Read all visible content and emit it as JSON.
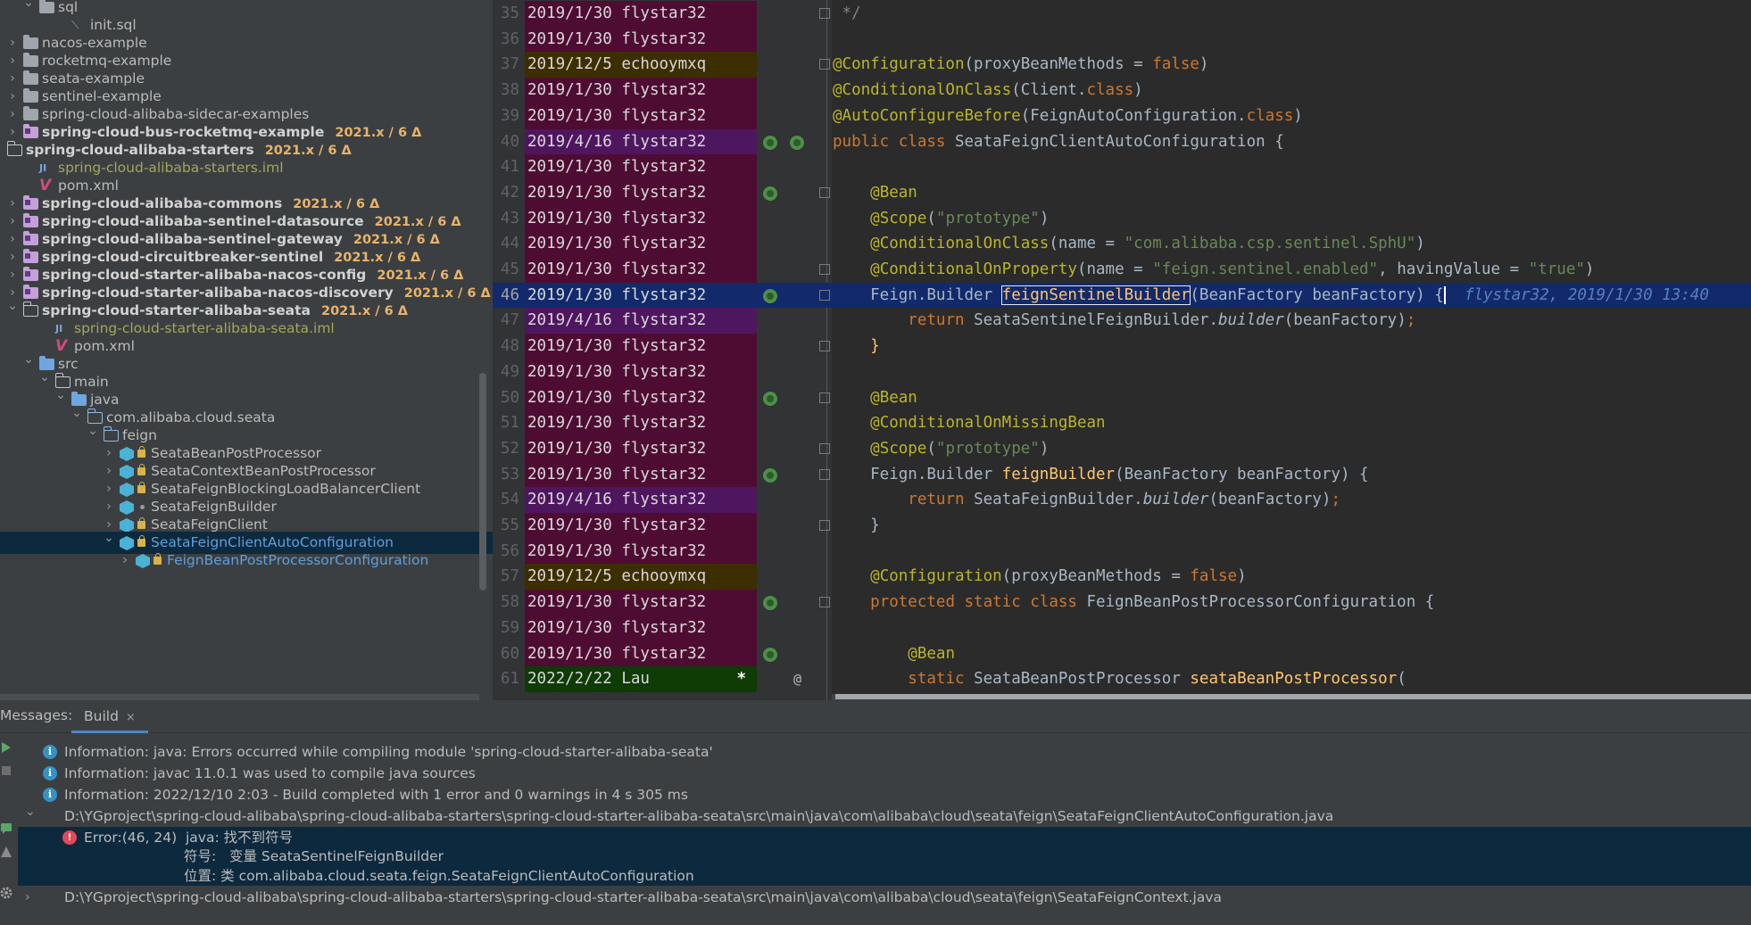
{
  "project_tree": {
    "items": [
      {
        "label": "sql",
        "indent": 1,
        "arrow": "down",
        "icon": "folder",
        "style": "normal"
      },
      {
        "label": "init.sql",
        "indent": 3,
        "arrow": "",
        "icon": "sql-file",
        "style": "normal"
      },
      {
        "label": "nacos-example",
        "indent": 0,
        "arrow": "right",
        "icon": "folder",
        "style": "normal"
      },
      {
        "label": "rocketmq-example",
        "indent": 0,
        "arrow": "right",
        "icon": "folder",
        "style": "normal"
      },
      {
        "label": "seata-example",
        "indent": 0,
        "arrow": "right",
        "icon": "folder",
        "style": "normal"
      },
      {
        "label": "sentinel-example",
        "indent": 0,
        "arrow": "right",
        "icon": "folder",
        "style": "normal"
      },
      {
        "label": "spring-cloud-alibaba-sidecar-examples",
        "indent": 0,
        "arrow": "right",
        "icon": "folder",
        "style": "normal"
      },
      {
        "label": "spring-cloud-bus-rocketmq-example",
        "tag": "2021.x / 6 Δ",
        "indent": 0,
        "arrow": "right",
        "icon": "module",
        "style": "module"
      },
      {
        "label": "spring-cloud-alibaba-starters",
        "tag": "2021.x / 6 Δ",
        "indent": -1,
        "arrow": "",
        "icon": "folder-outline",
        "style": "module"
      },
      {
        "label": "spring-cloud-alibaba-starters.iml",
        "indent": 1,
        "arrow": "",
        "icon": "iml-file",
        "style": "ignored"
      },
      {
        "label": "pom.xml",
        "indent": 1,
        "arrow": "",
        "icon": "maven-file",
        "style": "normal"
      },
      {
        "label": "spring-cloud-alibaba-commons",
        "tag": "2021.x / 6 Δ",
        "indent": 0,
        "arrow": "right",
        "icon": "module",
        "style": "module"
      },
      {
        "label": "spring-cloud-alibaba-sentinel-datasource",
        "tag": "2021.x / 6 Δ",
        "indent": 0,
        "arrow": "right",
        "icon": "module",
        "style": "module"
      },
      {
        "label": "spring-cloud-alibaba-sentinel-gateway",
        "tag": "2021.x / 6 Δ",
        "indent": 0,
        "arrow": "right",
        "icon": "module",
        "style": "module"
      },
      {
        "label": "spring-cloud-circuitbreaker-sentinel",
        "tag": "2021.x / 6 Δ",
        "indent": 0,
        "arrow": "right",
        "icon": "module",
        "style": "module"
      },
      {
        "label": "spring-cloud-starter-alibaba-nacos-config",
        "tag": "2021.x / 6 Δ",
        "indent": 0,
        "arrow": "right",
        "icon": "module",
        "style": "module"
      },
      {
        "label": "spring-cloud-starter-alibaba-nacos-discovery",
        "tag": "2021.x / 6 Δ",
        "indent": 0,
        "arrow": "right",
        "icon": "module",
        "style": "module"
      },
      {
        "label": "spring-cloud-starter-alibaba-seata",
        "tag": "2021.x / 6 Δ",
        "indent": 0,
        "arrow": "down",
        "icon": "module-outline",
        "style": "module"
      },
      {
        "label": "spring-cloud-starter-alibaba-seata.iml",
        "indent": 2,
        "arrow": "",
        "icon": "iml-file",
        "style": "ignored"
      },
      {
        "label": "pom.xml",
        "indent": 2,
        "arrow": "",
        "icon": "maven-file",
        "style": "normal"
      },
      {
        "label": "src",
        "indent": 1,
        "arrow": "down",
        "icon": "folder-src",
        "style": "normal"
      },
      {
        "label": "main",
        "indent": 2,
        "arrow": "down",
        "icon": "folder-outline",
        "style": "normal"
      },
      {
        "label": "java",
        "indent": 3,
        "arrow": "down",
        "icon": "folder-src",
        "style": "normal"
      },
      {
        "label": "com.alibaba.cloud.seata",
        "indent": 4,
        "arrow": "down",
        "icon": "package",
        "style": "normal"
      },
      {
        "label": "feign",
        "indent": 5,
        "arrow": "down",
        "icon": "package",
        "style": "normal"
      },
      {
        "label": "SeataBeanPostProcessor",
        "indent": 6,
        "arrow": "right",
        "icon": "class",
        "lock": true,
        "style": "normal"
      },
      {
        "label": "SeataContextBeanPostProcessor",
        "indent": 6,
        "arrow": "right",
        "icon": "class",
        "lock": true,
        "style": "normal"
      },
      {
        "label": "SeataFeignBlockingLoadBalancerClient",
        "indent": 6,
        "arrow": "right",
        "icon": "class",
        "lock": true,
        "style": "normal"
      },
      {
        "label": "SeataFeignBuilder",
        "indent": 6,
        "arrow": "right",
        "icon": "class",
        "dot": true,
        "style": "normal"
      },
      {
        "label": "SeataFeignClient",
        "indent": 6,
        "arrow": "right",
        "icon": "class",
        "lock": true,
        "style": "normal"
      },
      {
        "label": "SeataFeignClientAutoConfiguration",
        "indent": 6,
        "arrow": "down",
        "icon": "class",
        "lock": true,
        "style": "selected"
      },
      {
        "label": "FeignBeanPostProcessorConfiguration",
        "indent": 7,
        "arrow": "right",
        "icon": "class",
        "lock": true,
        "style": "selected-partial"
      }
    ]
  },
  "editor": {
    "lines": [
      {
        "num": "35",
        "blame": "2019/1/30 flystar32",
        "kind": "a",
        "gicon": false,
        "fold": true,
        "code": [
          [
            "cmt",
            " */"
          ]
        ]
      },
      {
        "num": "36",
        "blame": "2019/1/30 flystar32",
        "kind": "a",
        "gicon": false,
        "fold": false,
        "code": []
      },
      {
        "num": "37",
        "blame": "2019/12/5 echooymxq",
        "kind": "b",
        "gicon": false,
        "fold": true,
        "code": [
          [
            "ann",
            "@Configuration"
          ],
          [
            "",
            "(proxyBeanMethods = "
          ],
          [
            "kw",
            "false"
          ],
          [
            "",
            ")"
          ]
        ]
      },
      {
        "num": "38",
        "blame": "2019/1/30 flystar32",
        "kind": "a",
        "gicon": false,
        "fold": false,
        "code": [
          [
            "ann",
            "@ConditionalOnClass"
          ],
          [
            "",
            "(Client."
          ],
          [
            "kw",
            "class"
          ],
          [
            "",
            ")"
          ]
        ]
      },
      {
        "num": "39",
        "blame": "2019/1/30 flystar32",
        "kind": "a",
        "gicon": false,
        "fold": false,
        "code": [
          [
            "ann",
            "@AutoConfigureBefore"
          ],
          [
            "",
            "(FeignAutoConfiguration."
          ],
          [
            "kw",
            "class"
          ],
          [
            "",
            ")"
          ]
        ]
      },
      {
        "num": "40",
        "blame": "2019/4/16 flystar32",
        "kind": "c",
        "gicon": true,
        "fold": false,
        "code": [
          [
            "kw",
            "public class "
          ],
          [
            "",
            "SeataFeignClientAutoConfiguration {"
          ]
        ]
      },
      {
        "num": "41",
        "blame": "2019/1/30 flystar32",
        "kind": "a",
        "gicon": false,
        "fold": false,
        "code": []
      },
      {
        "num": "42",
        "blame": "2019/1/30 flystar32",
        "kind": "a",
        "gicon": true,
        "fold": true,
        "code": [
          [
            "",
            "    "
          ],
          [
            "ann",
            "@Bean"
          ]
        ]
      },
      {
        "num": "43",
        "blame": "2019/1/30 flystar32",
        "kind": "a",
        "gicon": false,
        "fold": false,
        "code": [
          [
            "",
            "    "
          ],
          [
            "ann",
            "@Scope"
          ],
          [
            "",
            "("
          ],
          [
            "str",
            "\"prototype\""
          ],
          [
            "",
            ")"
          ]
        ]
      },
      {
        "num": "44",
        "blame": "2019/1/30 flystar32",
        "kind": "a",
        "gicon": false,
        "fold": false,
        "code": [
          [
            "",
            "    "
          ],
          [
            "ann",
            "@ConditionalOnClass"
          ],
          [
            "",
            "(name = "
          ],
          [
            "str",
            "\"com.alibaba.csp.sentinel.SphU\""
          ],
          [
            "",
            ")"
          ]
        ]
      },
      {
        "num": "45",
        "blame": "2019/1/30 flystar32",
        "kind": "a",
        "gicon": false,
        "fold": true,
        "code": [
          [
            "",
            "    "
          ],
          [
            "ann",
            "@ConditionalOnProperty"
          ],
          [
            "",
            "(name = "
          ],
          [
            "str",
            "\"feign.sentinel.enabled\""
          ],
          [
            "",
            ", havingValue = "
          ],
          [
            "str",
            "\"true\""
          ],
          [
            "",
            ")"
          ]
        ]
      },
      {
        "num": "46",
        "blame": "2019/1/30 flystar32",
        "kind": "a",
        "gicon": true,
        "fold": true,
        "current": true,
        "code": [
          [
            "",
            "    Feign.Builder "
          ],
          [
            "fn hl",
            "feignSentinelBuilder"
          ],
          [
            "",
            "(BeanFactory beanFactory) {"
          ],
          [
            "caret",
            ""
          ],
          [
            "",
            "  "
          ],
          [
            "inlay",
            "flystar32, 2019/1/30 13:40"
          ]
        ]
      },
      {
        "num": "47",
        "blame": "2019/4/16 flystar32",
        "kind": "c",
        "gicon": false,
        "fold": false,
        "code": [
          [
            "",
            "        "
          ],
          [
            "kw",
            "return "
          ],
          [
            "",
            "SeataSentinelFeignBuilder."
          ],
          [
            "it",
            "builder"
          ],
          [
            "",
            "(beanFactory)"
          ],
          [
            "kw",
            ";"
          ]
        ]
      },
      {
        "num": "48",
        "blame": "2019/1/30 flystar32",
        "kind": "a",
        "gicon": false,
        "fold": true,
        "code": [
          [
            "",
            "    "
          ],
          [
            "fn",
            "}"
          ]
        ]
      },
      {
        "num": "49",
        "blame": "2019/1/30 flystar32",
        "kind": "a",
        "gicon": false,
        "fold": false,
        "code": []
      },
      {
        "num": "50",
        "blame": "2019/1/30 flystar32",
        "kind": "a",
        "gicon": true,
        "fold": true,
        "code": [
          [
            "",
            "    "
          ],
          [
            "ann",
            "@Bean"
          ]
        ]
      },
      {
        "num": "51",
        "blame": "2019/1/30 flystar32",
        "kind": "a",
        "gicon": false,
        "fold": false,
        "code": [
          [
            "",
            "    "
          ],
          [
            "ann",
            "@ConditionalOnMissingBean"
          ]
        ]
      },
      {
        "num": "52",
        "blame": "2019/1/30 flystar32",
        "kind": "a",
        "gicon": false,
        "fold": true,
        "code": [
          [
            "",
            "    "
          ],
          [
            "ann",
            "@Scope"
          ],
          [
            "",
            "("
          ],
          [
            "str",
            "\"prototype\""
          ],
          [
            "",
            ")"
          ]
        ]
      },
      {
        "num": "53",
        "blame": "2019/1/30 flystar32",
        "kind": "a",
        "gicon": true,
        "fold": true,
        "code": [
          [
            "",
            "    Feign.Builder "
          ],
          [
            "fn",
            "feignBuilder"
          ],
          [
            "",
            "(BeanFactory beanFactory) {"
          ]
        ]
      },
      {
        "num": "54",
        "blame": "2019/4/16 flystar32",
        "kind": "c",
        "gicon": false,
        "fold": false,
        "code": [
          [
            "",
            "        "
          ],
          [
            "kw",
            "return "
          ],
          [
            "",
            "SeataFeignBuilder."
          ],
          [
            "it",
            "builder"
          ],
          [
            "",
            "(beanFactory)"
          ],
          [
            "kw",
            ";"
          ]
        ]
      },
      {
        "num": "55",
        "blame": "2019/1/30 flystar32",
        "kind": "a",
        "gicon": false,
        "fold": true,
        "code": [
          [
            "",
            "    }"
          ]
        ]
      },
      {
        "num": "56",
        "blame": "2019/1/30 flystar32",
        "kind": "a",
        "gicon": false,
        "fold": false,
        "code": []
      },
      {
        "num": "57",
        "blame": "2019/12/5 echooymxq",
        "kind": "b",
        "gicon": false,
        "fold": false,
        "code": [
          [
            "",
            "    "
          ],
          [
            "ann",
            "@Configuration"
          ],
          [
            "",
            "(proxyBeanMethods = "
          ],
          [
            "kw",
            "false"
          ],
          [
            "",
            ")"
          ]
        ]
      },
      {
        "num": "58",
        "blame": "2019/1/30 flystar32",
        "kind": "a",
        "gicon": true,
        "fold": true,
        "code": [
          [
            "",
            "    "
          ],
          [
            "kw",
            "protected static class "
          ],
          [
            "",
            "FeignBeanPostProcessorConfiguration {"
          ]
        ]
      },
      {
        "num": "59",
        "blame": "2019/1/30 flystar32",
        "kind": "a",
        "gicon": false,
        "fold": false,
        "code": []
      },
      {
        "num": "60",
        "blame": "2019/1/30 flystar32",
        "kind": "a",
        "gicon": true,
        "fold": false,
        "code": [
          [
            "",
            "        "
          ],
          [
            "ann",
            "@Bean"
          ]
        ]
      },
      {
        "num": "61",
        "blame": "2022/2/22 Lau",
        "kind": "d",
        "star": "*",
        "at": "@",
        "gicon": false,
        "fold": false,
        "code": [
          [
            "",
            "        "
          ],
          [
            "kw",
            "static "
          ],
          [
            "",
            "SeataBeanPostProcessor "
          ],
          [
            "fn",
            "seataBeanPostProcessor"
          ],
          [
            "",
            "("
          ]
        ]
      }
    ]
  },
  "messages": {
    "title": "Messages:",
    "tab_label": "Build",
    "tab_close": "×",
    "rows": [
      {
        "type": "info",
        "indent": 0,
        "text": "Information: java: Errors occurred while compiling module 'spring-cloud-starter-alibaba-seata'"
      },
      {
        "type": "info",
        "indent": 0,
        "text": "Information: javac 11.0.1 was used to compile java sources"
      },
      {
        "type": "info",
        "indent": 0,
        "text": "Information: 2022/12/10 2:03 - Build completed with 1 error and 0 warnings in 4 s 305 ms"
      },
      {
        "type": "file-open",
        "indent": 0,
        "text": "D:\\YGproject\\spring-cloud-alibaba\\spring-cloud-alibaba-starters\\spring-cloud-starter-alibaba-seata\\src\\main\\java\\com\\alibaba\\cloud\\seata\\feign\\SeataFeignClientAutoConfiguration.java"
      },
      {
        "type": "error",
        "indent": 1,
        "text": "Error:(46, 24)  java: 找不到符号"
      },
      {
        "type": "error-detail",
        "indent": 2,
        "text": "符号:   变量 SeataSentinelFeignBuilder"
      },
      {
        "type": "error-detail",
        "indent": 2,
        "text": "位置: 类 com.alibaba.cloud.seata.feign.SeataFeignClientAutoConfiguration"
      },
      {
        "type": "file-closed",
        "indent": 0,
        "text": "D:\\YGproject\\spring-cloud-alibaba\\spring-cloud-alibaba-starters\\spring-cloud-starter-alibaba-seata\\src\\main\\java\\com\\alibaba\\cloud\\seata\\feign\\SeataFeignContext.java"
      }
    ]
  },
  "colors": {
    "blame_default": "#4e0c33",
    "blame_echooymxq": "#3d2e00",
    "blame_2019_4_16": "#4f1660",
    "blame_lau": "#0f3b05",
    "current_line": "#122a6b",
    "vcs_tag": "#e8b36a"
  }
}
